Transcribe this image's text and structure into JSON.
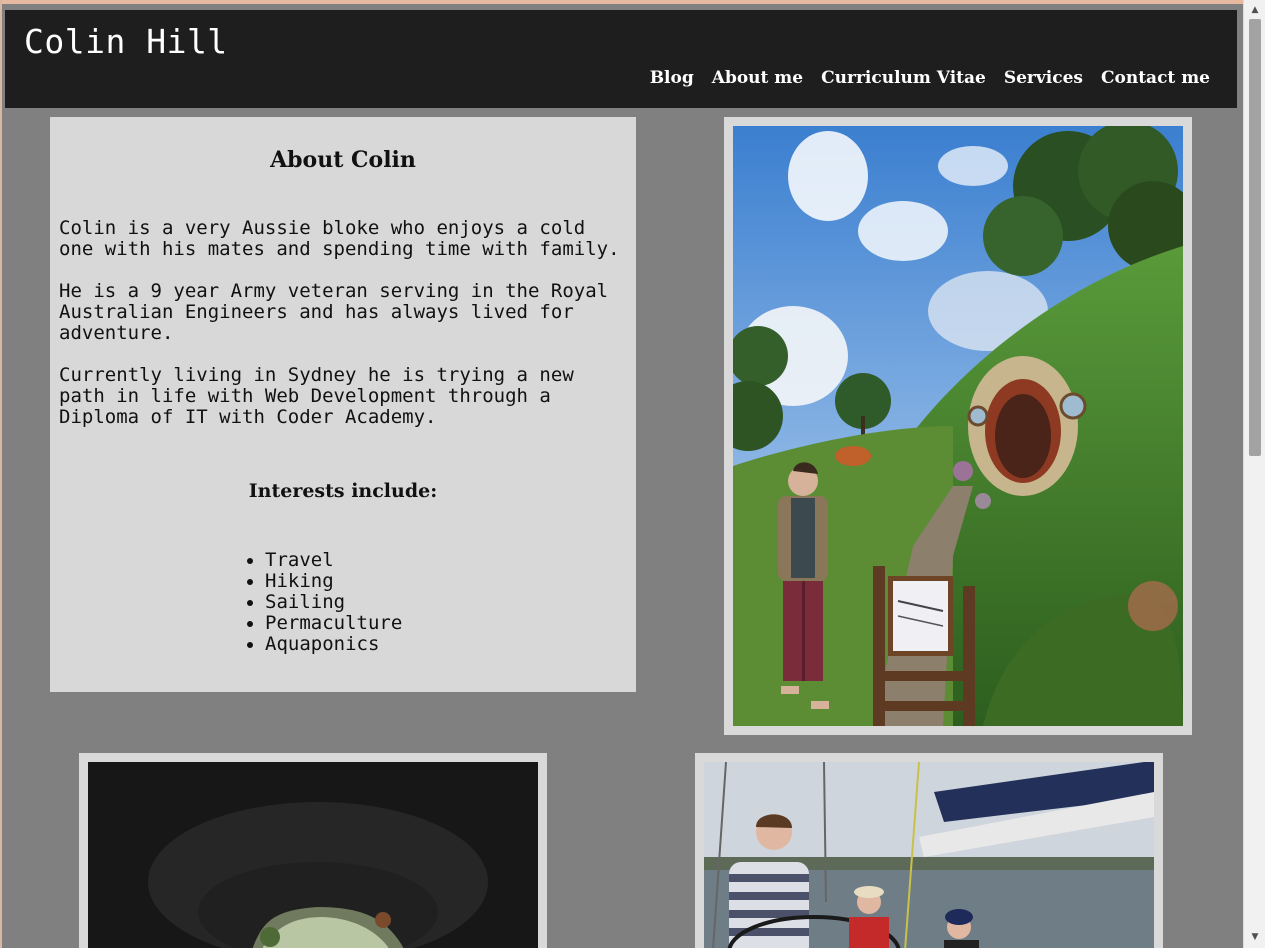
{
  "site": {
    "title": "Colin Hill"
  },
  "nav": {
    "items": [
      {
        "label": "Blog"
      },
      {
        "label": "About me"
      },
      {
        "label": "Curriculum Vitae"
      },
      {
        "label": "Services"
      },
      {
        "label": "Contact me"
      }
    ]
  },
  "about": {
    "heading": "About Colin",
    "paragraphs": [
      "Colin is a very Aussie bloke who enjoys a cold one with his mates and spending time with family.",
      "He is a 9 year Army veteran serving in the Royal Australian Engineers and has always lived for adventure.",
      "Currently living in Sydney he is trying a new path in life with Web Development through a Diploma of IT with Coder Academy."
    ],
    "interests_heading": "Interests include:",
    "interests": [
      "Travel",
      "Hiking",
      "Sailing",
      "Permaculture",
      "Aquaponics"
    ]
  },
  "colors": {
    "header_bg": "#1e1e1e",
    "page_bg": "#808080",
    "card_bg": "#d8d8d8"
  },
  "icons": {
    "scroll_up": "arrow-up-icon",
    "scroll_down": "arrow-down-icon"
  }
}
